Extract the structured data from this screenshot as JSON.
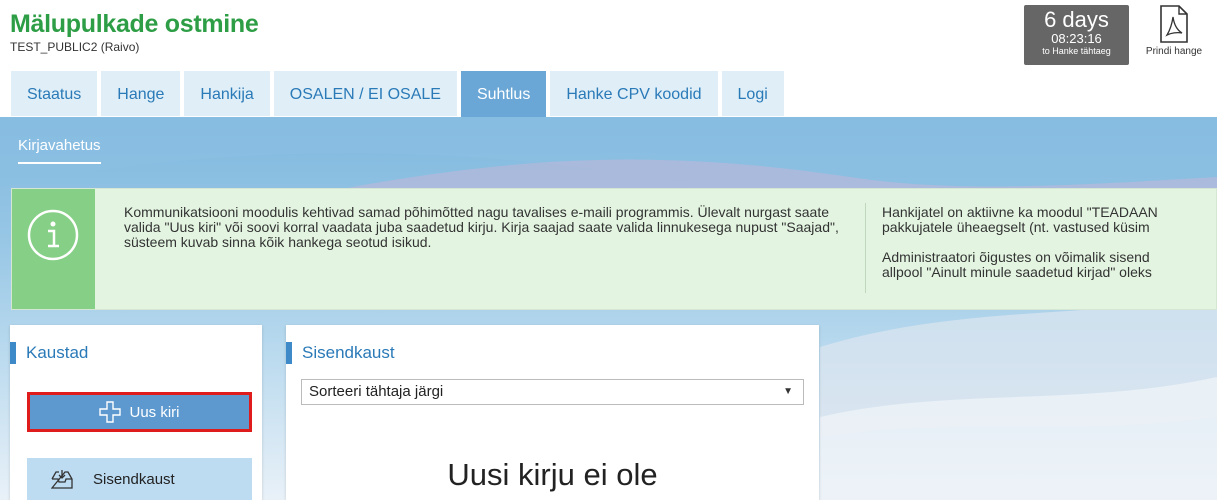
{
  "header": {
    "title": "Mälupulkade ostmine",
    "subtitle": "TEST_PUBLIC2 (Raivo)",
    "countdown_days": "6 days",
    "countdown_time": "08:23:16",
    "countdown_label": "to Hanke tähtaeg",
    "print_label": "Prindi hange"
  },
  "tabs": [
    {
      "label": "Staatus"
    },
    {
      "label": "Hange"
    },
    {
      "label": "Hankija"
    },
    {
      "label": "OSALEN / EI OSALE"
    },
    {
      "label": "Suhtlus",
      "active": true
    },
    {
      "label": "Hanke CPV koodid"
    },
    {
      "label": "Logi"
    }
  ],
  "subnav": {
    "label": "Kirjavahetus"
  },
  "info": {
    "text1": "Kommunikatsiooni moodulis kehtivad samad põhimõtted nagu tavalises e-maili programmis. Ülevalt nurgast saate valida \"Uus kiri\" või soovi korral vaadata juba saadetud kirju. Kirja saajad saate valida linnukesega nupust \"Saajad\", süsteem kuvab sinna kõik hankega seotud isikud.",
    "text2a": "Hankijatel on aktiivne ka moodul \"TEADAAN",
    "text2b": "pakkujatele üheaegselt (nt. vastused küsim",
    "text2c": "Administraatori õigustes on võimalik sisend",
    "text2d": "allpool \"Ainult minule saadetud kirjad\" oleks"
  },
  "folders": {
    "title": "Kaustad",
    "new_label": "Uus kiri",
    "inbox_label": "Sisendkaust"
  },
  "inbox": {
    "title": "Sisendkaust",
    "sort_label": "Sorteeri tähtaja järgi",
    "empty_message": "Uusi kirju ei ole"
  },
  "colors": {
    "title_green": "#2e9e46",
    "tab_active": "#6aa7d6",
    "tab_inactive": "#dfeef7",
    "info_bg": "#e3f5e1",
    "info_icon_bg": "#86cf86",
    "button_blue": "#5d99cf",
    "highlight_red": "#e01b1b"
  }
}
